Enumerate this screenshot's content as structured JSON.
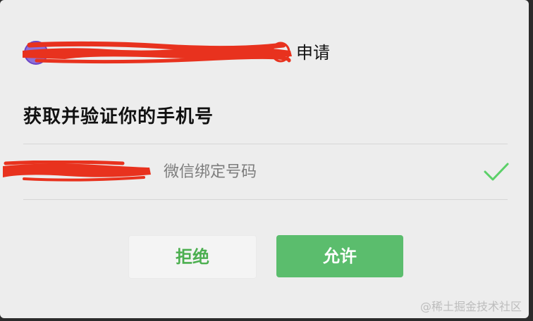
{
  "dialog": {
    "app_request_suffix": "申请",
    "title": "获取并验证你的手机号",
    "phone_description": "微信绑定号码",
    "reject_label": "拒绝",
    "allow_label": "允许"
  },
  "watermark": "@稀土掘金技术社区",
  "colors": {
    "accent_green": "#5bbd6d",
    "check_green": "#5bd068",
    "redaction_red": "#e8321e",
    "dialog_bg": "#ededed"
  },
  "icons": {
    "check": "check-icon",
    "avatar": "app-avatar"
  }
}
